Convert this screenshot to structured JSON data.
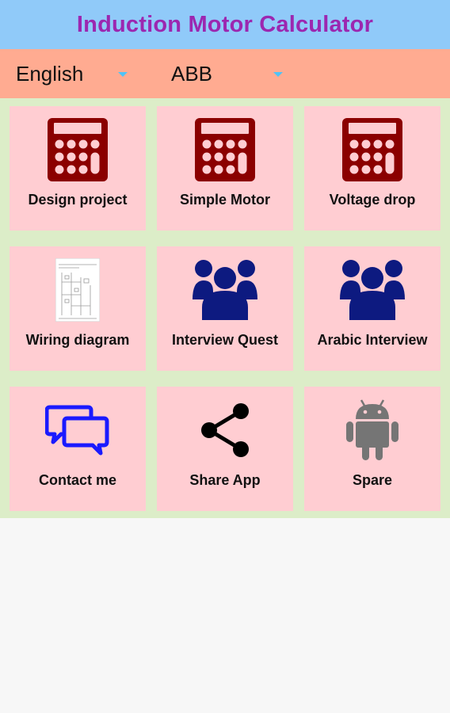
{
  "app": {
    "title": "Induction Motor Calculator"
  },
  "selectors": {
    "language": {
      "value": "English",
      "icon": "dropdown-arrow"
    },
    "brand": {
      "value": "ABB",
      "icon": "dropdown-arrow"
    }
  },
  "colors": {
    "header_bg": "#90caf9",
    "title_text": "#9c27b0",
    "selector_bar_bg": "#ffab91",
    "grid_bg": "#dcedc8",
    "tile_bg": "#ffcdd2",
    "calculator_icon": "#8b0000",
    "people_icon": "#0d1a80",
    "chat_icon": "#1a1aff",
    "android_icon": "#757575"
  },
  "tiles": [
    {
      "label": "Design project",
      "icon": "calculator-icon"
    },
    {
      "label": "Simple Motor",
      "icon": "calculator-icon"
    },
    {
      "label": "Voltage drop",
      "icon": "calculator-icon"
    },
    {
      "label": "Wiring diagram",
      "icon": "wiring-diagram-icon"
    },
    {
      "label": "Interview Quest",
      "icon": "people-group-icon"
    },
    {
      "label": "Arabic Interview",
      "icon": "people-group-icon"
    },
    {
      "label": "Contact me",
      "icon": "chat-bubbles-icon"
    },
    {
      "label": "Share App",
      "icon": "share-icon"
    },
    {
      "label": "Spare",
      "icon": "android-icon"
    }
  ]
}
